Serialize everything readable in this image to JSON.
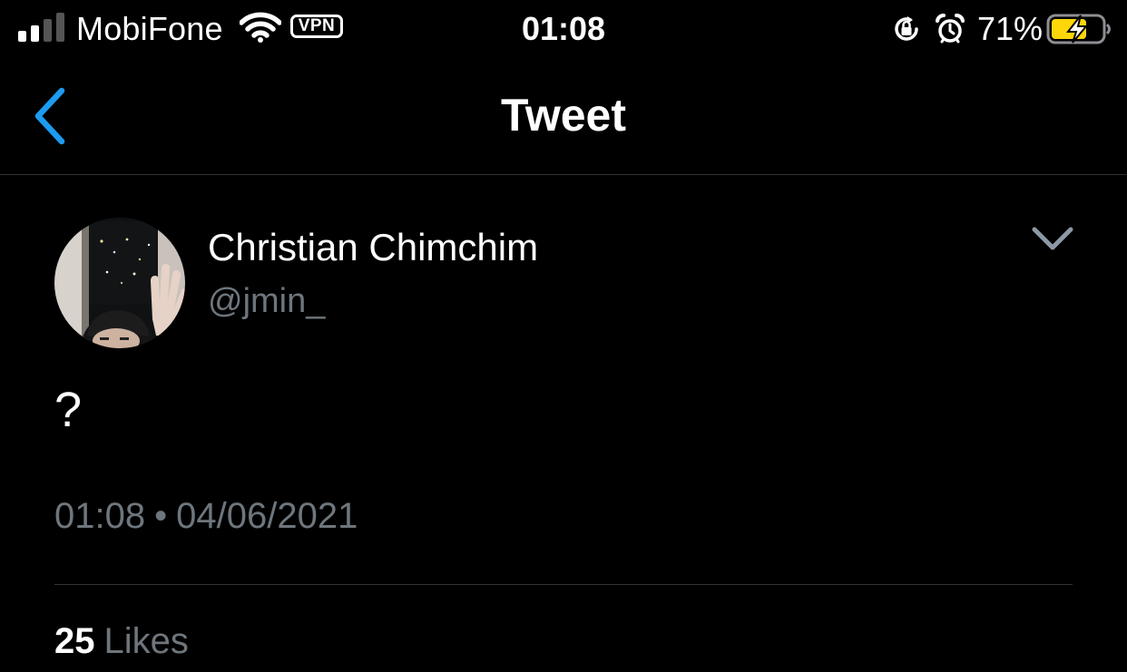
{
  "colors": {
    "background": "#000000",
    "text_primary": "#ffffff",
    "text_secondary": "#6e767d",
    "accent": "#1d9bf0",
    "divider": "#2f3336",
    "battery_charging": "#ffd60a"
  },
  "status_bar": {
    "signal_bars_active": 2,
    "signal_bars_total": 4,
    "carrier": "MobiFone",
    "wifi_icon": "wifi-icon",
    "vpn_label": "VPN",
    "time": "01:08",
    "rotation_lock_icon": "rotation-lock-icon",
    "alarm_icon": "alarm-icon",
    "battery_percent_label": "71%",
    "battery_level": 0.71,
    "battery_charging": true
  },
  "nav": {
    "back_icon": "chevron-left-icon",
    "title": "Tweet"
  },
  "tweet": {
    "author_name": "Christian Chimchim",
    "author_handle": "@jmin_",
    "more_icon": "chevron-down-icon",
    "text": "?",
    "time": "01:08",
    "separator": "•",
    "date": "04/06/2021",
    "likes_count": "25",
    "likes_label": "Likes"
  }
}
